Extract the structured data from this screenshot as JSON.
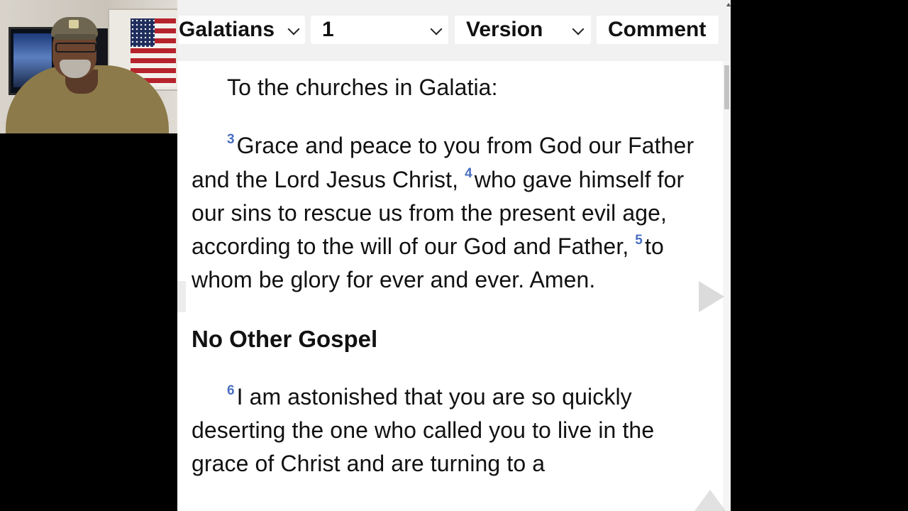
{
  "toolbar": {
    "book": "Galatians",
    "chapter": "1",
    "version": "Version",
    "commentary": "Comment"
  },
  "passage": {
    "salutation": "To the churches in Galatia:",
    "v3_num": "3",
    "v3_text": "Grace and peace to you from God our Father and the Lord Jesus Christ, ",
    "v4_num": "4",
    "v4_text": "who gave himself for our sins to rescue us from the present evil age, according to the will of our God and Father, ",
    "v5_num": "5",
    "v5_text": "to whom be glory for ever and ever. Amen.",
    "heading": "No Other Gospel",
    "v6_num": "6",
    "v6_text": "I am astonished that you are so quickly deserting the one who called you to live in the grace of Christ and are turning to a"
  },
  "icons": {
    "next": "arrow-right-icon",
    "prev": "arrow-left-icon",
    "top": "arrow-up-icon",
    "dropdown": "chevron-down-icon"
  },
  "colors": {
    "verse_number": "#4a6fc0",
    "toolbar_bg": "#f1f1f1",
    "text": "#111111"
  }
}
